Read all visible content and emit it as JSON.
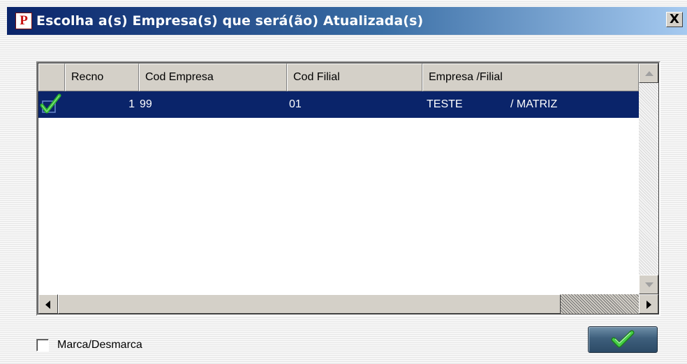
{
  "window": {
    "title": "Escolha a(s) Empresa(s) que será(ão) Atualizada(s)",
    "icon": "app-p-icon",
    "close_label": "X"
  },
  "grid": {
    "columns": [
      "",
      "Recno",
      "Cod Empresa",
      "Cod Filial",
      "Empresa /Filial"
    ],
    "rows": [
      {
        "checked": true,
        "recno": "1",
        "cod_empresa": "99",
        "cod_filial": "01",
        "empresa": "TESTE",
        "filial": "/ MATRIZ",
        "selected": true
      }
    ]
  },
  "footer": {
    "toggle_label": "Marca/Desmarca",
    "toggle_checked": false,
    "confirm_icon": "green-check-icon"
  },
  "colors": {
    "title_gradient_start": "#0a246a",
    "title_gradient_end": "#a6caf0",
    "selection": "#0a246a",
    "check_green": "#2db52d"
  }
}
